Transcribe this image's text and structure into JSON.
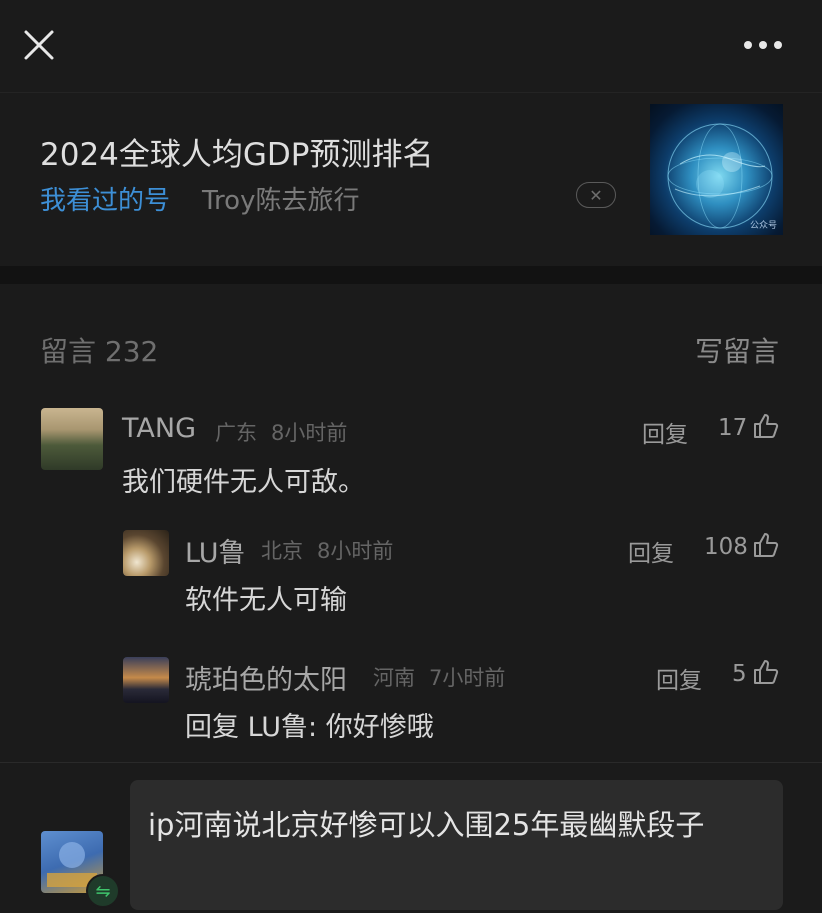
{
  "topbar": {
    "close_icon": "close-icon",
    "more_icon": "more-dots-icon"
  },
  "article": {
    "title": "2024全球人均GDP预测排名",
    "source_label": "我看过的号",
    "author": "Troy陈去旅行",
    "dismiss_symbol": "✕",
    "thumbnail_watermark": "公众号"
  },
  "comments_header": {
    "count_label": "留言 232",
    "write_label": "写留言"
  },
  "comments": [
    {
      "name": "TANG",
      "location": "广东",
      "time": "8小时前",
      "reply_label": "回复",
      "likes": "17",
      "text": "我们硬件无人可敌。"
    },
    {
      "name": "LU鲁",
      "location": "北京",
      "time": "8小时前",
      "reply_label": "回复",
      "likes": "108",
      "text": "软件无人可输"
    },
    {
      "name": "琥珀色的太阳",
      "location": "河南",
      "time": "7小时前",
      "reply_label": "回复",
      "likes": "5",
      "text": "回复 LU鲁: 你好惨哦"
    }
  ],
  "input": {
    "value": "ip河南说北京好惨可以入围25年最幽默段子",
    "switch_symbol": "⇋"
  },
  "colors": {
    "background": "#1b1b1b",
    "link_blue": "#3d8fd6",
    "accent_green": "#3fc46b"
  }
}
